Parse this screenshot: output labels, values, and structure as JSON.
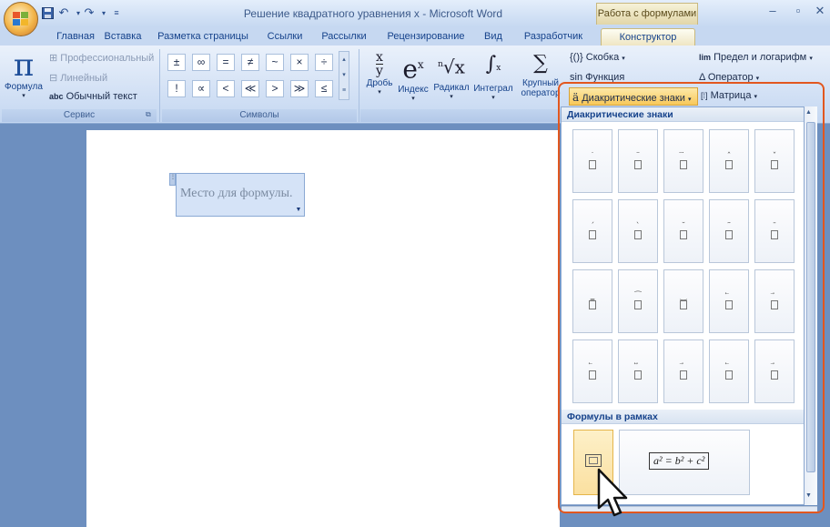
{
  "window": {
    "title": "Решение квадратного уравнения x - Microsoft Word",
    "context_title": "Работа с формулами"
  },
  "tabs": [
    "Главная",
    "Вставка",
    "Разметка страницы",
    "Ссылки",
    "Рассылки",
    "Рецензирование",
    "Вид",
    "Разработчик",
    "Конструктор"
  ],
  "ribbon": {
    "service": {
      "formula_label": "Формула",
      "professional": "Профессиональный",
      "linear": "Линейный",
      "normal_text": "Обычный текст",
      "normal_text_prefix": "abc",
      "group_label": "Сервис"
    },
    "symbols": {
      "row1": [
        "±",
        "∞",
        "=",
        "≠",
        "~",
        "×",
        "÷"
      ],
      "row2": [
        "!",
        "∝",
        "<",
        "≪",
        ">",
        "≫",
        "≤"
      ],
      "group_label": "Символы"
    },
    "structures": {
      "fraction": "Дробь",
      "index": "Индекс",
      "radical": "Радикал",
      "integral": "Интеграл",
      "large_operator_1": "Крупный",
      "large_operator_2": "оператор",
      "bracket": "Скобка",
      "function": "Функция",
      "limit_log": "Предел и логарифм",
      "operator": "Оператор",
      "accents": "Диакритические знаки",
      "matrix": "Матрица"
    }
  },
  "document": {
    "formula_placeholder": "Место для формулы."
  },
  "gallery": {
    "section1_title": "Диакритические знаки",
    "section2_title": "Формулы в рамках",
    "boxed_formula": "a² = b² + c²",
    "accent_marks": [
      "˙",
      "¨",
      "⃛",
      "ˆ",
      "ˇ",
      "´",
      "`",
      "˘",
      "˜",
      "¯",
      "‗",
      "⁀",
      "‿",
      "⃖",
      "⃗",
      "⃖",
      "⃡",
      "⃗",
      "⃖",
      "⃗"
    ]
  },
  "colors": {
    "highlight_frame": "#e2571f",
    "ribbon_bg": "#d3e1f5",
    "doc_bg": "#6d8fbf"
  }
}
